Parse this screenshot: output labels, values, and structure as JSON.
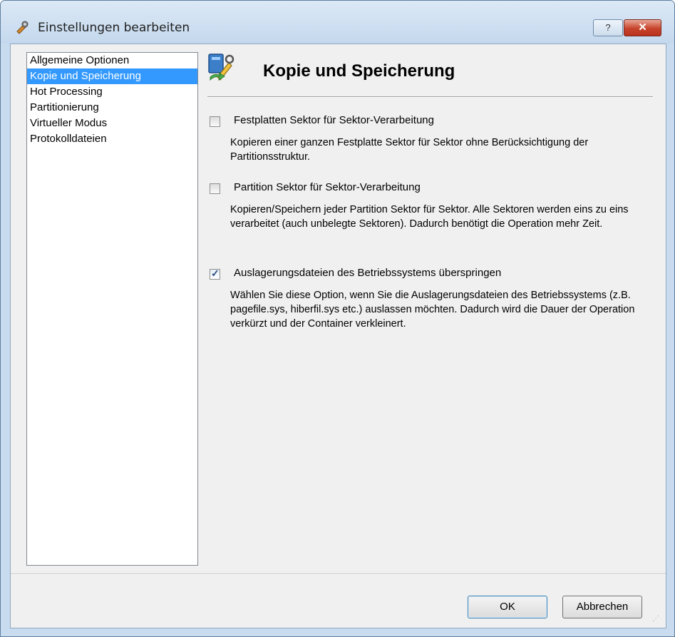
{
  "window": {
    "title": "Einstellungen bearbeiten",
    "help_label": "?",
    "close_label": "✕"
  },
  "sidebar": {
    "items": [
      {
        "label": "Allgemeine Optionen",
        "selected": false
      },
      {
        "label": "Kopie und Speicherung",
        "selected": true
      },
      {
        "label": "Hot Processing",
        "selected": false
      },
      {
        "label": "Partitionierung",
        "selected": false
      },
      {
        "label": "Virtueller Modus",
        "selected": false
      },
      {
        "label": "Protokolldateien",
        "selected": false
      }
    ]
  },
  "main": {
    "heading": "Kopie und Speicherung",
    "options": [
      {
        "label": "Festplatten Sektor für Sektor-Verarbeitung",
        "checked": false,
        "description": "Kopieren einer ganzen Festplatte Sektor für Sektor ohne Berücksichtigung der Partitionsstruktur."
      },
      {
        "label": "Partition Sektor für Sektor-Verarbeitung",
        "checked": false,
        "description": "Kopieren/Speichern jeder Partition Sektor für Sektor. Alle Sektoren werden eins zu eins verarbeitet (auch unbelegte Sektoren). Dadurch benötigt die Operation mehr Zeit."
      },
      {
        "label": "Auslagerungsdateien des Betriebssystems überspringen",
        "checked": true,
        "description": "Wählen Sie diese Option, wenn Sie die Auslagerungsdateien des Betriebssystems (z.B. pagefile.sys, hiberfil.sys etc.) auslassen möchten. Dadurch wird die Dauer der Operation verkürzt und der Container verkleinert."
      }
    ]
  },
  "footer": {
    "ok_label": "OK",
    "cancel_label": "Abbrechen"
  },
  "colors": {
    "selection": "#3399ff",
    "titlebar": "#c9dcef"
  }
}
